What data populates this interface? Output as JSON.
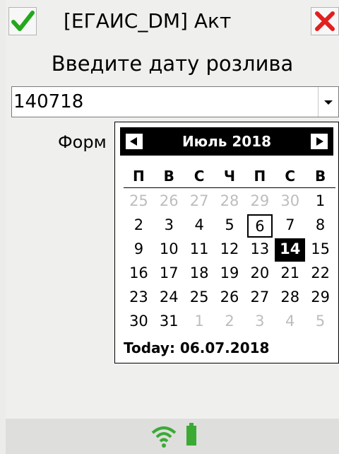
{
  "titlebar": {
    "title": "[ЕГАИС_DM] Акт",
    "ok_icon": "checkmark-icon",
    "close_icon": "close-icon",
    "ok_color": "#22a91a",
    "close_color": "#e02020"
  },
  "prompt": "Введите дату розлива",
  "date_input": {
    "value": "140718"
  },
  "format_label": "Форм",
  "calendar": {
    "month_year": "Июль 2018",
    "weekdays": [
      "П",
      "В",
      "С",
      "Ч",
      "П",
      "С",
      "В"
    ],
    "weeks": [
      [
        {
          "d": "25",
          "other": true
        },
        {
          "d": "26",
          "other": true
        },
        {
          "d": "27",
          "other": true
        },
        {
          "d": "28",
          "other": true
        },
        {
          "d": "29",
          "other": true
        },
        {
          "d": "30",
          "other": true
        },
        {
          "d": "1"
        }
      ],
      [
        {
          "d": "2"
        },
        {
          "d": "3"
        },
        {
          "d": "4"
        },
        {
          "d": "5"
        },
        {
          "d": "6",
          "today": true
        },
        {
          "d": "7"
        },
        {
          "d": "8"
        }
      ],
      [
        {
          "d": "9"
        },
        {
          "d": "10"
        },
        {
          "d": "11"
        },
        {
          "d": "12"
        },
        {
          "d": "13"
        },
        {
          "d": "14",
          "selected": true
        },
        {
          "d": "15"
        }
      ],
      [
        {
          "d": "16"
        },
        {
          "d": "17"
        },
        {
          "d": "18"
        },
        {
          "d": "19"
        },
        {
          "d": "20"
        },
        {
          "d": "21"
        },
        {
          "d": "22"
        }
      ],
      [
        {
          "d": "23"
        },
        {
          "d": "24"
        },
        {
          "d": "25"
        },
        {
          "d": "26"
        },
        {
          "d": "27"
        },
        {
          "d": "28"
        },
        {
          "d": "29"
        }
      ],
      [
        {
          "d": "30"
        },
        {
          "d": "31"
        },
        {
          "d": "1",
          "other": true
        },
        {
          "d": "2",
          "other": true
        },
        {
          "d": "3",
          "other": true
        },
        {
          "d": "4",
          "other": true
        },
        {
          "d": "5",
          "other": true
        }
      ]
    ],
    "today_label": "Today: 06.07.2018"
  },
  "statusbar": {
    "wifi_icon": "wifi-icon",
    "battery_icon": "battery-icon",
    "status_color": "#3aaa35"
  }
}
